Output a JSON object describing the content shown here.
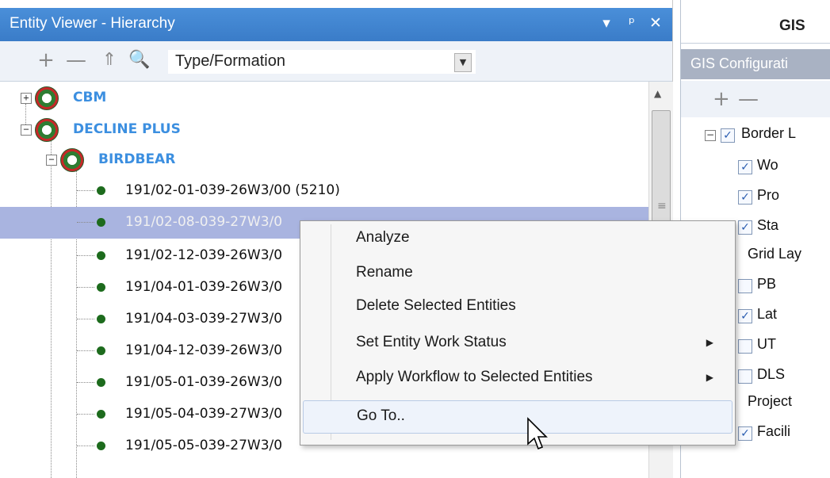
{
  "left_panel": {
    "title": "Entity Viewer - Hierarchy",
    "title_buttons": [
      "▾",
      "ᵖ",
      "✕"
    ],
    "toolbar": {
      "add": "+",
      "remove": "—",
      "up": "⇑",
      "search": "🔍",
      "combo_value": "Type/Formation"
    },
    "tree": {
      "root_nodes": [
        {
          "label": "CBM",
          "expanded": false
        },
        {
          "label": "DECLINE PLUS",
          "expanded": true
        }
      ],
      "child_node": {
        "label": "BIRDBEAR",
        "expanded": true
      },
      "leaves": [
        "191/02-01-039-26W3/00 (5210)",
        "191/02-08-039-27W3/0",
        "191/02-12-039-26W3/0",
        "191/04-01-039-26W3/0",
        "191/04-03-039-27W3/0",
        "191/04-12-039-26W3/0",
        "191/05-01-039-26W3/0",
        "191/05-04-039-27W3/0",
        "191/05-05-039-27W3/0"
      ],
      "selected_index": 1
    }
  },
  "right_panel": {
    "tab_label": "GIS",
    "title": "GIS Configurati",
    "toolbar": {
      "add": "+",
      "remove": "—"
    },
    "items": [
      {
        "label": "Border L",
        "checked": true,
        "group": true
      },
      {
        "label": "Wo",
        "checked": true
      },
      {
        "label": "Pro",
        "checked": true
      },
      {
        "label": "Sta",
        "checked": true
      },
      {
        "label": "Grid Lay",
        "checked": null,
        "group": true
      },
      {
        "label": "PB",
        "checked": false
      },
      {
        "label": "Lat",
        "checked": true
      },
      {
        "label": "UT",
        "checked": false
      },
      {
        "label": "DLS",
        "checked": false
      },
      {
        "label": "Project",
        "checked": null,
        "group": true
      },
      {
        "label": "Facili",
        "checked": true
      }
    ]
  },
  "context_menu": {
    "items": [
      {
        "label": "Analyze",
        "submenu": false
      },
      {
        "label": "Rename",
        "submenu": false
      },
      {
        "label": "Delete Selected Entities",
        "submenu": false
      },
      {
        "label": "Set Entity Work Status",
        "submenu": true
      },
      {
        "label": "Apply Workflow to Selected Entities",
        "submenu": true
      },
      {
        "label": "Go To..",
        "submenu": false,
        "hover": true
      }
    ]
  },
  "colors": {
    "title_bar": "#3f86d4",
    "selection": "#a9b4e0",
    "node_label": "#3c8fe0",
    "leaf_dot": "#1d6b1d"
  }
}
